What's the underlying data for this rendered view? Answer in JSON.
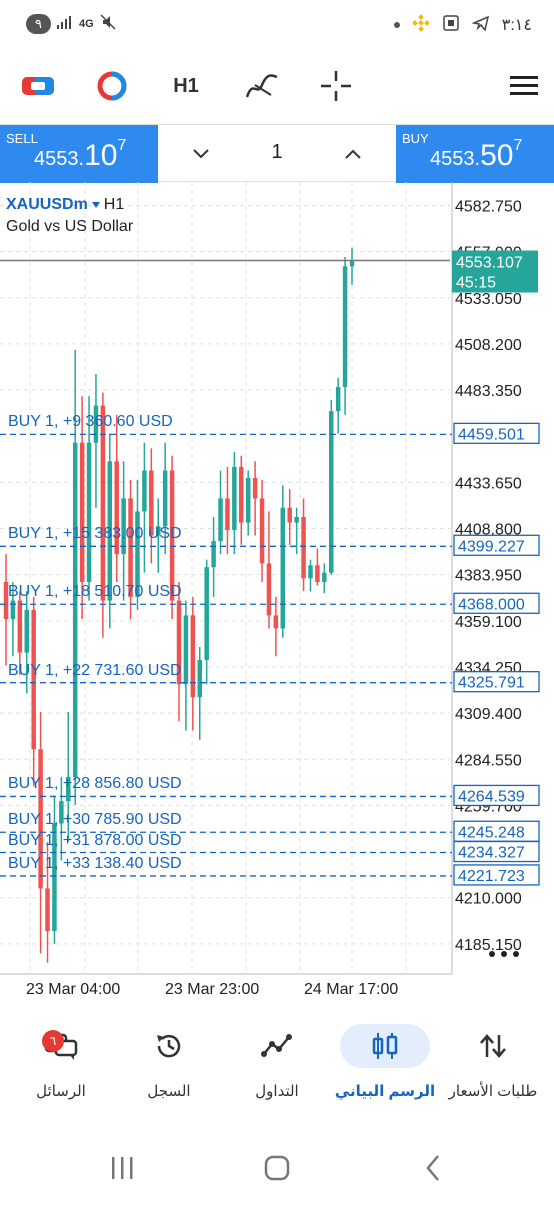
{
  "status_bar": {
    "time": "٣:١٤",
    "notification_count": "٩",
    "network": "4G"
  },
  "toolbar": {
    "timeframe": "H1"
  },
  "trade": {
    "sell_label": "SELL",
    "sell_price_main": "4553.",
    "sell_price_big": "10",
    "sell_price_sup": "7",
    "buy_label": "BUY",
    "buy_price_main": "4553.",
    "buy_price_big": "50",
    "buy_price_sup": "7",
    "lot": "1"
  },
  "chart_data": {
    "type": "candlestick",
    "symbol": "XAUUSDm",
    "timeframe": "H1",
    "description": "Gold vs US Dollar",
    "y_range": [
      4170,
      4590
    ],
    "y_ticks": [
      "4582.750",
      "4557.900",
      "4533.050",
      "4508.200",
      "4483.350",
      "4433.650",
      "4408.800",
      "4383.950",
      "4359.100",
      "4334.250",
      "4309.400",
      "4284.550",
      "4259.700",
      "4210.000",
      "4185.150"
    ],
    "x_labels": [
      "23 Mar 04:00",
      "23 Mar 23:00",
      "24 Mar 17:00"
    ],
    "current_price": "4553.107",
    "countdown": "45:15",
    "candles": [
      [
        4380,
        4395,
        4335,
        4360
      ],
      [
        4360,
        4380,
        4340,
        4370
      ],
      [
        4370,
        4375,
        4330,
        4342
      ],
      [
        4342,
        4375,
        4320,
        4365
      ],
      [
        4365,
        4372,
        4270,
        4290
      ],
      [
        4290,
        4310,
        4180,
        4215
      ],
      [
        4215,
        4240,
        4175,
        4192
      ],
      [
        4192,
        4265,
        4185,
        4250
      ],
      [
        4250,
        4275,
        4230,
        4262
      ],
      [
        4262,
        4310,
        4240,
        4275
      ],
      [
        4275,
        4505,
        4260,
        4455
      ],
      [
        4455,
        4480,
        4360,
        4380
      ],
      [
        4380,
        4480,
        4370,
        4455
      ],
      [
        4455,
        4492,
        4420,
        4475
      ],
      [
        4475,
        4482,
        4350,
        4370
      ],
      [
        4370,
        4460,
        4355,
        4445
      ],
      [
        4445,
        4470,
        4380,
        4395
      ],
      [
        4395,
        4445,
        4370,
        4425
      ],
      [
        4425,
        4435,
        4360,
        4372
      ],
      [
        4372,
        4435,
        4365,
        4418
      ],
      [
        4418,
        4455,
        4385,
        4440
      ],
      [
        4440,
        4452,
        4390,
        4405
      ],
      [
        4405,
        4425,
        4385,
        4410
      ],
      [
        4410,
        4455,
        4395,
        4440
      ],
      [
        4440,
        4448,
        4360,
        4370
      ],
      [
        4370,
        4380,
        4305,
        4325
      ],
      [
        4325,
        4370,
        4300,
        4362
      ],
      [
        4362,
        4372,
        4300,
        4318
      ],
      [
        4318,
        4345,
        4295,
        4338
      ],
      [
        4338,
        4392,
        4325,
        4388
      ],
      [
        4388,
        4415,
        4372,
        4402
      ],
      [
        4402,
        4440,
        4395,
        4425
      ],
      [
        4425,
        4442,
        4395,
        4408
      ],
      [
        4408,
        4450,
        4395,
        4442
      ],
      [
        4442,
        4448,
        4400,
        4412
      ],
      [
        4412,
        4440,
        4405,
        4436
      ],
      [
        4436,
        4445,
        4405,
        4425
      ],
      [
        4425,
        4435,
        4380,
        4390
      ],
      [
        4390,
        4418,
        4355,
        4362
      ],
      [
        4362,
        4372,
        4340,
        4355
      ],
      [
        4355,
        4432,
        4350,
        4420
      ],
      [
        4420,
        4430,
        4400,
        4412
      ],
      [
        4412,
        4420,
        4395,
        4415
      ],
      [
        4415,
        4425,
        4375,
        4382
      ],
      [
        4382,
        4392,
        4375,
        4389
      ],
      [
        4389,
        4398,
        4378,
        4380
      ],
      [
        4380,
        4390,
        4374,
        4385
      ],
      [
        4385,
        4478,
        4384,
        4472
      ],
      [
        4472,
        4490,
        4460,
        4485
      ],
      [
        4485,
        4555,
        4470,
        4550
      ],
      [
        4550,
        4560,
        4540,
        4553
      ]
    ],
    "orders": [
      {
        "label": "BUY 1,  +9 360.60 USD",
        "price": "4459.501"
      },
      {
        "label": "BUY 1,  +15 383.00 USD",
        "price": "4399.227"
      },
      {
        "label": "BUY 1,  +18 510.70 USD",
        "price": "4368.000"
      },
      {
        "label": "BUY 1,  +22 731.60 USD",
        "price": "4325.791"
      },
      {
        "label": "BUY 1,  +28 856.80 USD",
        "price": "4264.539"
      },
      {
        "label": "BUY 1,  +30 785.90 USD",
        "price": "4245.248"
      },
      {
        "label": "BUY 1,  +31 878.00 USD",
        "price": "4234.327"
      },
      {
        "label": "BUY 1,  +33 138.40 USD",
        "price": "4221.723"
      }
    ],
    "colors": {
      "bull": "#26a69a",
      "bear": "#ef5350",
      "order_line": "#1565c0",
      "grid": "#e0e0e0"
    }
  },
  "nav": {
    "items": [
      {
        "label": "الرسائل",
        "badge": "٦"
      },
      {
        "label": "السجل"
      },
      {
        "label": "التداول"
      },
      {
        "label": "الرسم البياني"
      },
      {
        "label": "طلبات الأسعار"
      }
    ]
  }
}
